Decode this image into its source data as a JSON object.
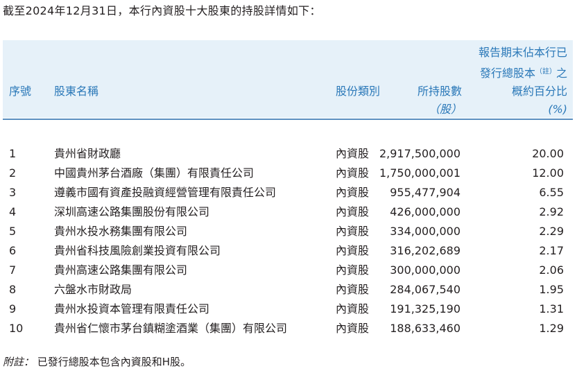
{
  "intro": "截至2024年12月31日，本行內資股十大股東的持股詳情如下：",
  "headers": {
    "no": "序號",
    "name": "股東名稱",
    "type": "股份類別",
    "shares": "所持股數",
    "shares_unit": "（股）",
    "pct_line1": "報告期末佔本行已",
    "pct_line2a": "發行總股本",
    "pct_note": "（註）",
    "pct_line2b": "之",
    "pct_line3": "概約百分比",
    "pct_unit": "(%)"
  },
  "rows": [
    {
      "no": "1",
      "name": "貴州省財政廳",
      "type": "內資股",
      "shares": "2,917,500,000",
      "pct": "20.00"
    },
    {
      "no": "2",
      "name": "中國貴州茅台酒廠（集團）有限責任公司",
      "type": "內資股",
      "shares": "1,750,000,001",
      "pct": "12.00"
    },
    {
      "no": "3",
      "name": "遵義市國有資產投融資經營管理有限責任公司",
      "type": "內資股",
      "shares": "955,477,904",
      "pct": "6.55"
    },
    {
      "no": "4",
      "name": "深圳高速公路集團股份有限公司",
      "type": "內資股",
      "shares": "426,000,000",
      "pct": "2.92"
    },
    {
      "no": "5",
      "name": "貴州水投水務集團有限公司",
      "type": "內資股",
      "shares": "334,000,000",
      "pct": "2.29"
    },
    {
      "no": "6",
      "name": "貴州省科技風險創業投資有限公司",
      "type": "內資股",
      "shares": "316,202,689",
      "pct": "2.17"
    },
    {
      "no": "7",
      "name": "貴州高速公路集團有限公司",
      "type": "內資股",
      "shares": "300,000,000",
      "pct": "2.06"
    },
    {
      "no": "8",
      "name": "六盤水市財政局",
      "type": "內資股",
      "shares": "284,067,540",
      "pct": "1.95"
    },
    {
      "no": "9",
      "name": "貴州水投資本管理有限責任公司",
      "type": "內資股",
      "shares": "191,325,190",
      "pct": "1.31"
    },
    {
      "no": "10",
      "name": "貴州省仁懷市茅台鎮糊塗酒業（集團）有限公司",
      "type": "內資股",
      "shares": "188,633,460",
      "pct": "1.29"
    }
  ],
  "note": {
    "label": "附註：",
    "text": "已發行總股本包含內資股和H股。"
  },
  "colors": {
    "header_bg": "#e6f1f9",
    "header_text": "#2a78b8",
    "rule": "#5a8fc0",
    "body_text": "#231f20"
  }
}
